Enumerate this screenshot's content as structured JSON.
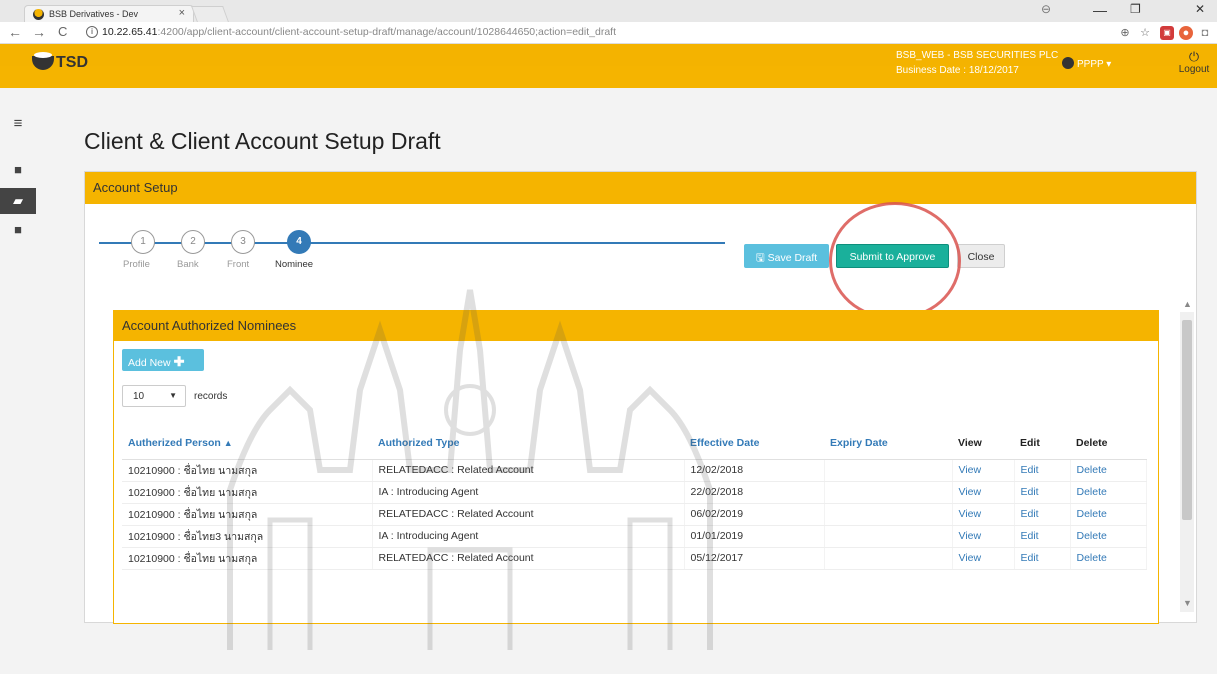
{
  "browser": {
    "tab_title": "BSB Derivatives - Dev",
    "tab_close": "×",
    "url_host": "10.22.65.41",
    "url_path": ":4200/app/client-account/client-account-setup-draft/manage/account/1028644650;action=edit_draft",
    "win_min": "—",
    "win_max": "❐",
    "win_close": "✕"
  },
  "header": {
    "brand": "TSD",
    "company": "BSB_WEB - BSB SECURITIES PLC",
    "business_date": "Business Date : 18/12/2017",
    "user": "PPPP",
    "logout": "Logout"
  },
  "page": {
    "title": "Client & Client Account Setup Draft",
    "panel_title": "Account Setup"
  },
  "steps": [
    {
      "num": "1",
      "label": "Profile"
    },
    {
      "num": "2",
      "label": "Bank"
    },
    {
      "num": "3",
      "label": "Front"
    },
    {
      "num": "4",
      "label": "Nominee"
    }
  ],
  "actions": {
    "save_draft": "Save Draft",
    "submit": "Submit to Approve",
    "close": "Close"
  },
  "nominees": {
    "title": "Account Authorized Nominees",
    "add_new": "Add New",
    "page_size": "10",
    "records_label": "records",
    "columns": [
      "Autherized Person",
      "Authorized Type",
      "Effective Date",
      "Expiry Date",
      "View",
      "Edit",
      "Delete"
    ],
    "rows": [
      {
        "person": "10210900 : ชื่อไทย นามสกุล",
        "type": "RELATEDACC : Related Account",
        "effective": "12/02/2018",
        "expiry": "",
        "view": "View",
        "edit": "Edit",
        "delete": "Delete"
      },
      {
        "person": "10210900 : ชื่อไทย นามสกุล",
        "type": "IA : Introducing Agent",
        "effective": "22/02/2018",
        "expiry": "",
        "view": "View",
        "edit": "Edit",
        "delete": "Delete"
      },
      {
        "person": "10210900 : ชื่อไทย นามสกุล",
        "type": "RELATEDACC : Related Account",
        "effective": "06/02/2019",
        "expiry": "",
        "view": "View",
        "edit": "Edit",
        "delete": "Delete"
      },
      {
        "person": "10210900 : ชื่อไทย3 นามสกุล",
        "type": "IA : Introducing Agent",
        "effective": "01/01/2019",
        "expiry": "",
        "view": "View",
        "edit": "Edit",
        "delete": "Delete"
      },
      {
        "person": "10210900 : ชื่อไทย นามสกุล",
        "type": "RELATEDACC : Related Account",
        "effective": "05/12/2017",
        "expiry": "",
        "view": "View",
        "edit": "Edit",
        "delete": "Delete"
      }
    ]
  },
  "colors": {
    "accent": "#f5b400",
    "link": "#337ab7",
    "save": "#5bc0de",
    "submit": "#1ab09b",
    "highlight": "#d9534f"
  }
}
